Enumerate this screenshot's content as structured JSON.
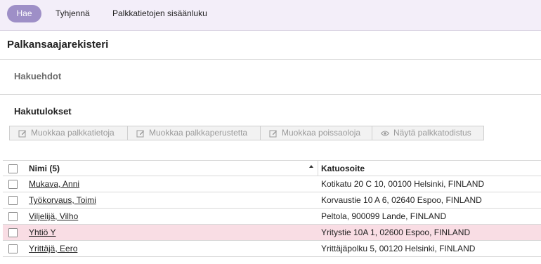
{
  "toolbar": {
    "search_label": "Hae",
    "clear_label": "Tyhjennä",
    "import_label": "Palkkatietojen sisäänluku",
    "accent_color": "#9e8fc7"
  },
  "page": {
    "title": "Palkansaajarekisteri"
  },
  "sections": {
    "criteria": "Hakuehdot",
    "results": "Hakutulokset"
  },
  "actions": [
    {
      "label": "Muokkaa palkkatietoja",
      "icon": "edit-icon"
    },
    {
      "label": "Muokkaa palkkaperustetta",
      "icon": "edit-icon"
    },
    {
      "label": "Muokkaa poissaoloja",
      "icon": "edit-icon"
    },
    {
      "label": "Näytä palkkatodistus",
      "icon": "eye-icon"
    }
  ],
  "table": {
    "columns": {
      "name": "Nimi (5)",
      "address": "Katuosoite"
    },
    "rows": [
      {
        "name": "Mukava, Anni",
        "address": "Kotikatu 20 C 10, 00100 Helsinki, FINLAND",
        "highlighted": false
      },
      {
        "name": "Työkorvaus, Toimi",
        "address": "Korvaustie 10 A 6, 02640 Espoo, FINLAND",
        "highlighted": false
      },
      {
        "name": "Viljelijä, Vilho",
        "address": "Peltola, 900099 Lande, FINLAND",
        "highlighted": false
      },
      {
        "name": "Yhtiö Y",
        "address": "Yritystie 10A 1, 02600 Espoo, FINLAND",
        "highlighted": true
      },
      {
        "name": "Yrittäjä, Eero",
        "address": "Yrittäjäpolku 5, 00120 Helsinki, FINLAND",
        "highlighted": false
      }
    ],
    "highlight_color": "#f9dde4"
  }
}
